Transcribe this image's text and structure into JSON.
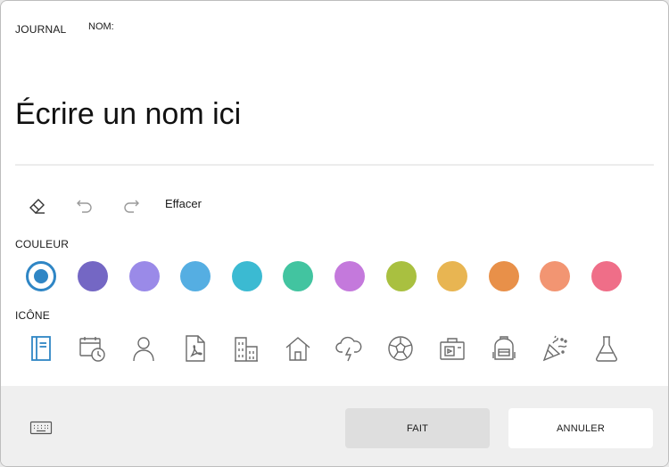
{
  "header": {
    "section_label": "JOURNAL",
    "name_label": "NOM:"
  },
  "name_field": {
    "placeholder": "Écrire un nom ici",
    "value": ""
  },
  "toolbar": {
    "clear_label": "Effacer",
    "icons": [
      "eraser-icon",
      "undo-icon",
      "redo-icon"
    ]
  },
  "color_section": {
    "label": "COULEUR",
    "selected_index": 0,
    "swatches": [
      "#2f86c5",
      "#7467c4",
      "#9a8ae8",
      "#55aee2",
      "#3bbad2",
      "#42c4a0",
      "#c479dc",
      "#a9c040",
      "#e8b552",
      "#e89049",
      "#f29572",
      "#ef6e88"
    ]
  },
  "icon_section": {
    "label": "ICÔNE",
    "selected_index": 0,
    "icons": [
      "notebook-icon",
      "calendar-clock-icon",
      "person-icon",
      "pdf-document-icon",
      "building-icon",
      "home-icon",
      "storm-cloud-icon",
      "soccer-ball-icon",
      "suitcase-icon",
      "backpack-icon",
      "party-popper-icon",
      "flask-icon"
    ],
    "selected_color": "#2f86c5",
    "icon_color": "#6a6a6a"
  },
  "footer": {
    "keyboard_icon": "keyboard-icon",
    "done_label": "FAIT",
    "cancel_label": "ANNULER"
  }
}
